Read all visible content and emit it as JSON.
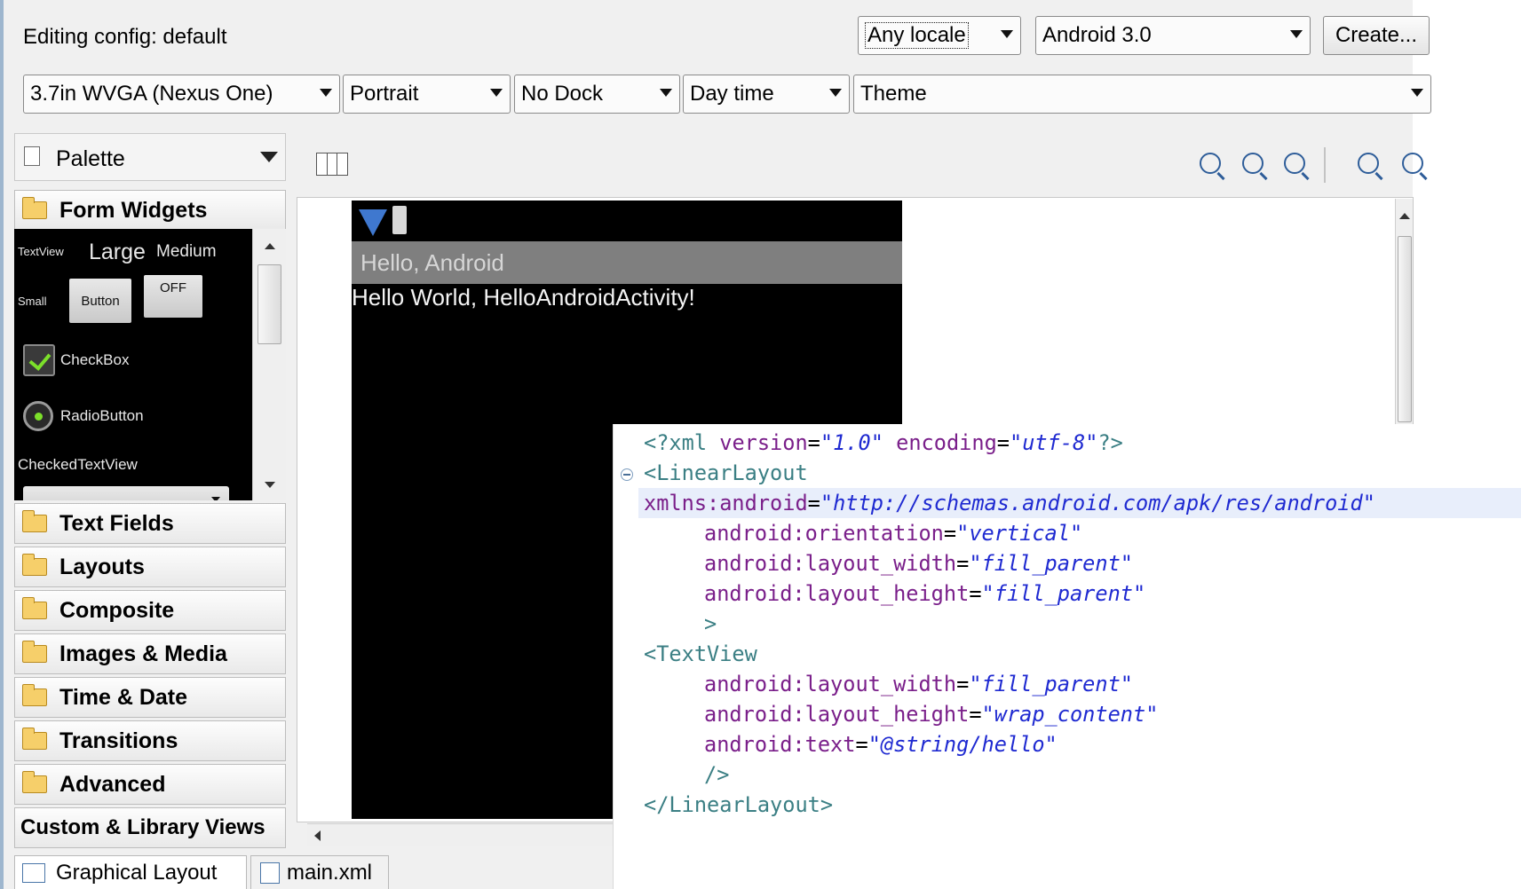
{
  "config_bar": {
    "label": "Editing config:  default",
    "locale": "Any locale",
    "api": "Android 3.0",
    "create": "Create..."
  },
  "device_bar": {
    "device": "3.7in WVGA (Nexus One)",
    "orientation": "Portrait",
    "dock": "No Dock",
    "time": "Day time",
    "theme": "Theme"
  },
  "palette": {
    "title": "Palette",
    "open_category": "Form Widgets",
    "widgets": {
      "textview": "TextView",
      "large": "Large",
      "medium": "Medium",
      "small": "Small",
      "button": "Button",
      "toggle": "OFF",
      "checkbox": "CheckBox",
      "radio": "RadioButton",
      "checked_textview": "CheckedTextView"
    },
    "categories": [
      "Text Fields",
      "Layouts",
      "Composite",
      "Images & Media",
      "Time & Date",
      "Transitions",
      "Advanced"
    ],
    "custom": "Custom & Library Views"
  },
  "preview": {
    "app_title": "Hello, Android",
    "text": "Hello World, HelloAndroidActivity!"
  },
  "code": {
    "l1": {
      "a": "<?xml ",
      "b": "version",
      "c": "=",
      "d": "\"1.0\"",
      "e": " ",
      "f": "encoding",
      "g": "=",
      "h": "\"utf-8\"",
      "i": "?>"
    },
    "l2": "<LinearLayout",
    "l3": {
      "attr": "xmlns:android",
      "val": "\"http://schemas.android.com/apk/res/android\""
    },
    "l4": {
      "attr": "android:orientation",
      "val": "\"vertical\""
    },
    "l5": {
      "attr": "android:layout_width",
      "val": "\"fill_parent\""
    },
    "l6": {
      "attr": "android:layout_height",
      "val": "\"fill_parent\""
    },
    "l7": ">",
    "l8": "<TextView",
    "l9": {
      "attr": "android:layout_width",
      "val": "\"fill_parent\""
    },
    "l10": {
      "attr": "android:layout_height",
      "val": "\"wrap_content\""
    },
    "l11": {
      "attr": "android:text",
      "val": "\"@string/hello\""
    },
    "l12": "/>",
    "l13": "</LinearLayout>"
  },
  "tabs": {
    "graphical": "Graphical Layout",
    "xml": "main.xml"
  }
}
